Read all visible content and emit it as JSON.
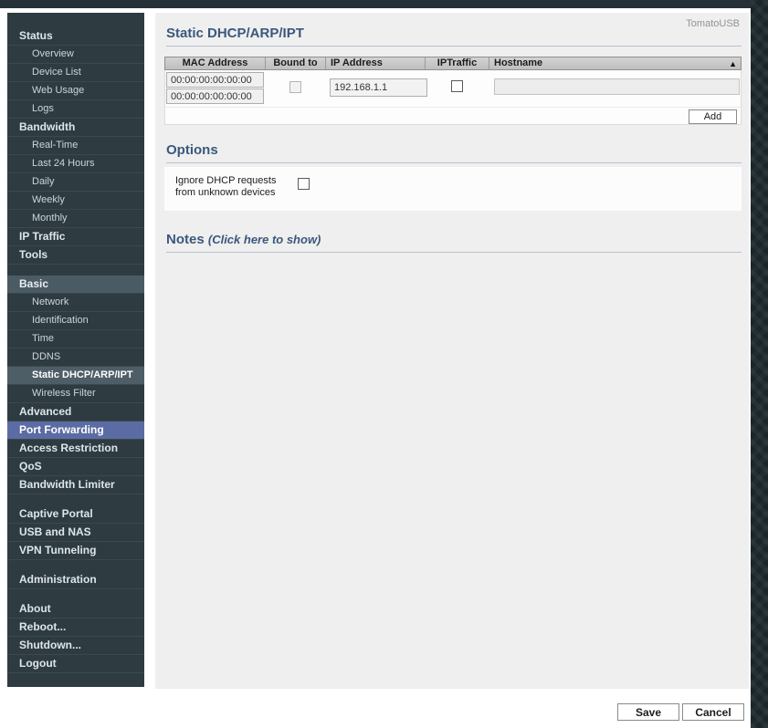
{
  "page": {
    "brand": "TomatoUSB",
    "title": "Static DHCP/ARP/IPT"
  },
  "colors": {
    "sidebar_bg": "#2e3b41",
    "sidebar_selected_bg": "#4e5e67",
    "sidebar_hover_bg": "#5b6ba3",
    "heading_text": "#3a587d",
    "table_header_bg": "#c6c6c6",
    "content_bg": "#efefef",
    "dark_band": "#1b262b"
  },
  "sidebar": {
    "items": [
      {
        "label": "Status",
        "type": "header",
        "state": "normal"
      },
      {
        "label": "Overview",
        "type": "sub",
        "state": "normal"
      },
      {
        "label": "Device List",
        "type": "sub",
        "state": "normal"
      },
      {
        "label": "Web Usage",
        "type": "sub",
        "state": "normal"
      },
      {
        "label": "Logs",
        "type": "sub",
        "state": "normal"
      },
      {
        "label": "Bandwidth",
        "type": "header",
        "state": "normal"
      },
      {
        "label": "Real-Time",
        "type": "sub",
        "state": "normal"
      },
      {
        "label": "Last 24 Hours",
        "type": "sub",
        "state": "normal"
      },
      {
        "label": "Daily",
        "type": "sub",
        "state": "normal"
      },
      {
        "label": "Weekly",
        "type": "sub",
        "state": "normal"
      },
      {
        "label": "Monthly",
        "type": "sub",
        "state": "normal"
      },
      {
        "label": "IP Traffic",
        "type": "header",
        "state": "normal"
      },
      {
        "label": "Tools",
        "type": "header",
        "state": "normal"
      },
      {
        "type": "spacer"
      },
      {
        "label": "Basic",
        "type": "header",
        "state": "section"
      },
      {
        "label": "Network",
        "type": "sub",
        "state": "normal"
      },
      {
        "label": "Identification",
        "type": "sub",
        "state": "normal"
      },
      {
        "label": "Time",
        "type": "sub",
        "state": "normal"
      },
      {
        "label": "DDNS",
        "type": "sub",
        "state": "normal"
      },
      {
        "label": "Static DHCP/ARP/IPT",
        "type": "sub",
        "state": "selected"
      },
      {
        "label": "Wireless Filter",
        "type": "sub",
        "state": "normal"
      },
      {
        "label": "Advanced",
        "type": "header",
        "state": "normal"
      },
      {
        "label": "Port Forwarding",
        "type": "header",
        "state": "hover"
      },
      {
        "label": "Access Restriction",
        "type": "header",
        "state": "normal"
      },
      {
        "label": "QoS",
        "type": "header",
        "state": "normal"
      },
      {
        "label": "Bandwidth Limiter",
        "type": "header",
        "state": "normal"
      },
      {
        "type": "spacer"
      },
      {
        "label": "Captive Portal",
        "type": "header",
        "state": "normal"
      },
      {
        "label": "USB and NAS",
        "type": "header",
        "state": "normal"
      },
      {
        "label": "VPN Tunneling",
        "type": "header",
        "state": "normal"
      },
      {
        "type": "spacer"
      },
      {
        "label": "Administration",
        "type": "header",
        "state": "normal"
      },
      {
        "type": "spacer"
      },
      {
        "label": "About",
        "type": "header",
        "state": "normal"
      },
      {
        "label": "Reboot...",
        "type": "header",
        "state": "normal"
      },
      {
        "label": "Shutdown...",
        "type": "header",
        "state": "normal"
      },
      {
        "label": "Logout",
        "type": "header",
        "state": "normal"
      }
    ]
  },
  "table": {
    "columns": [
      {
        "label": "MAC Address"
      },
      {
        "label": "Bound to"
      },
      {
        "label": "IP Address"
      },
      {
        "label": "IPTraffic"
      },
      {
        "label": "Hostname"
      }
    ],
    "sort_icon": "▲",
    "row": {
      "mac1": "00:00:00:00:00:00",
      "mac2": "00:00:00:00:00:00",
      "bound_checked": false,
      "ip": "192.168.1.1",
      "iptraffic_checked": false,
      "hostname": ""
    },
    "add_label": "Add"
  },
  "options": {
    "heading": "Options",
    "ignore_label": "Ignore DHCP requests\nfrom unknown devices",
    "ignore_checked": false
  },
  "notes": {
    "heading": "Notes",
    "toggle_label": "(Click here to show)"
  },
  "footer": {
    "save_label": "Save",
    "cancel_label": "Cancel"
  }
}
